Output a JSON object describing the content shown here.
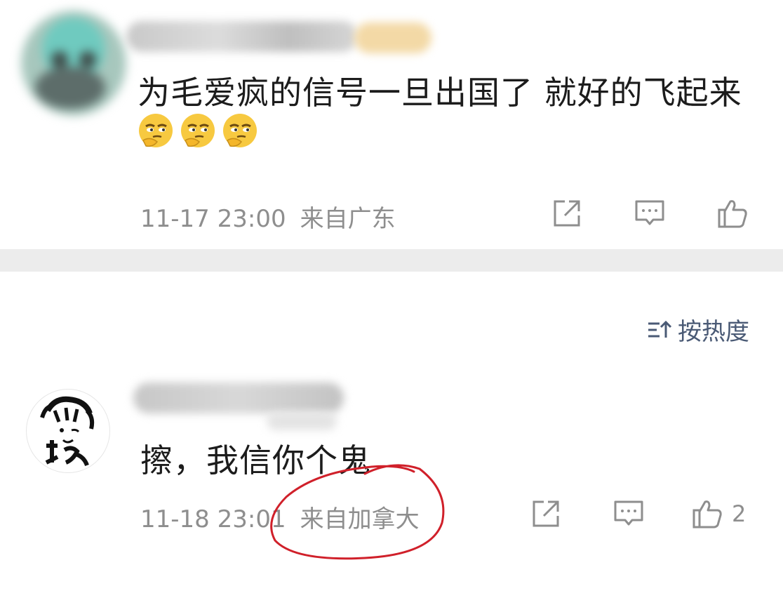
{
  "comments": [
    {
      "text": "为毛爱疯的信号一旦出国了 就好的飞起来",
      "emoji_count": 3,
      "emoji_icon": "smirk-hand-on-chin-emoji",
      "time": "11-17 23:00",
      "location": "来自广东",
      "like_count": ""
    },
    {
      "text": "擦，我信你个鬼",
      "time": "11-18 23:01",
      "location": "来自加拿大",
      "like_count": "2"
    }
  ],
  "sort": {
    "label": "按热度",
    "icon": "sort-icon"
  },
  "icons": [
    "share-icon",
    "comment-icon",
    "like-icon"
  ],
  "colors": {
    "annotation": "#d0202a",
    "meta": "#8e8e8e",
    "divider": "#ececec",
    "sort": "#4a5a75"
  }
}
